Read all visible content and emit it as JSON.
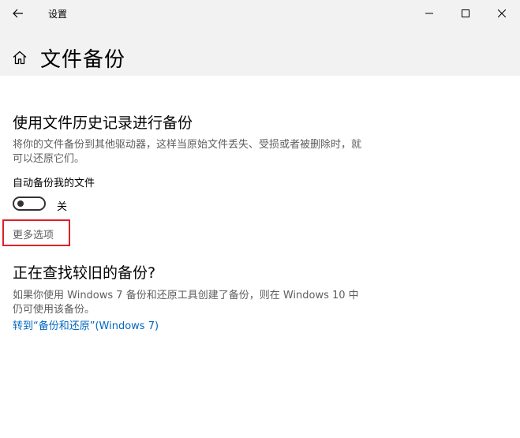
{
  "window": {
    "title": "设置"
  },
  "header": {
    "page_title": "文件备份"
  },
  "section_history": {
    "title": "使用文件历史记录进行备份",
    "description": "将你的文件备份到其他驱动器，这样当原始文件丢失、受损或者被删除时，就可以还原它们。",
    "auto_backup_label": "自动备份我的文件",
    "toggle_state": "关",
    "more_options": "更多选项"
  },
  "section_old": {
    "title": "正在查找较旧的备份?",
    "description": "如果你使用 Windows 7 备份和还原工具创建了备份，则在 Windows 10 中仍可使用该备份。",
    "link": "转到“备份和还原”(Windows 7)"
  },
  "colors": {
    "accent_link": "#0067c0",
    "highlight_box": "#e0202a",
    "secondary_text": "#5e5e5e",
    "chrome_bg": "#f2f2f2"
  },
  "icons": {
    "back": "arrow-left-icon",
    "minimize": "minimize-icon",
    "maximize": "maximize-icon",
    "close": "close-icon",
    "home": "home-icon"
  }
}
